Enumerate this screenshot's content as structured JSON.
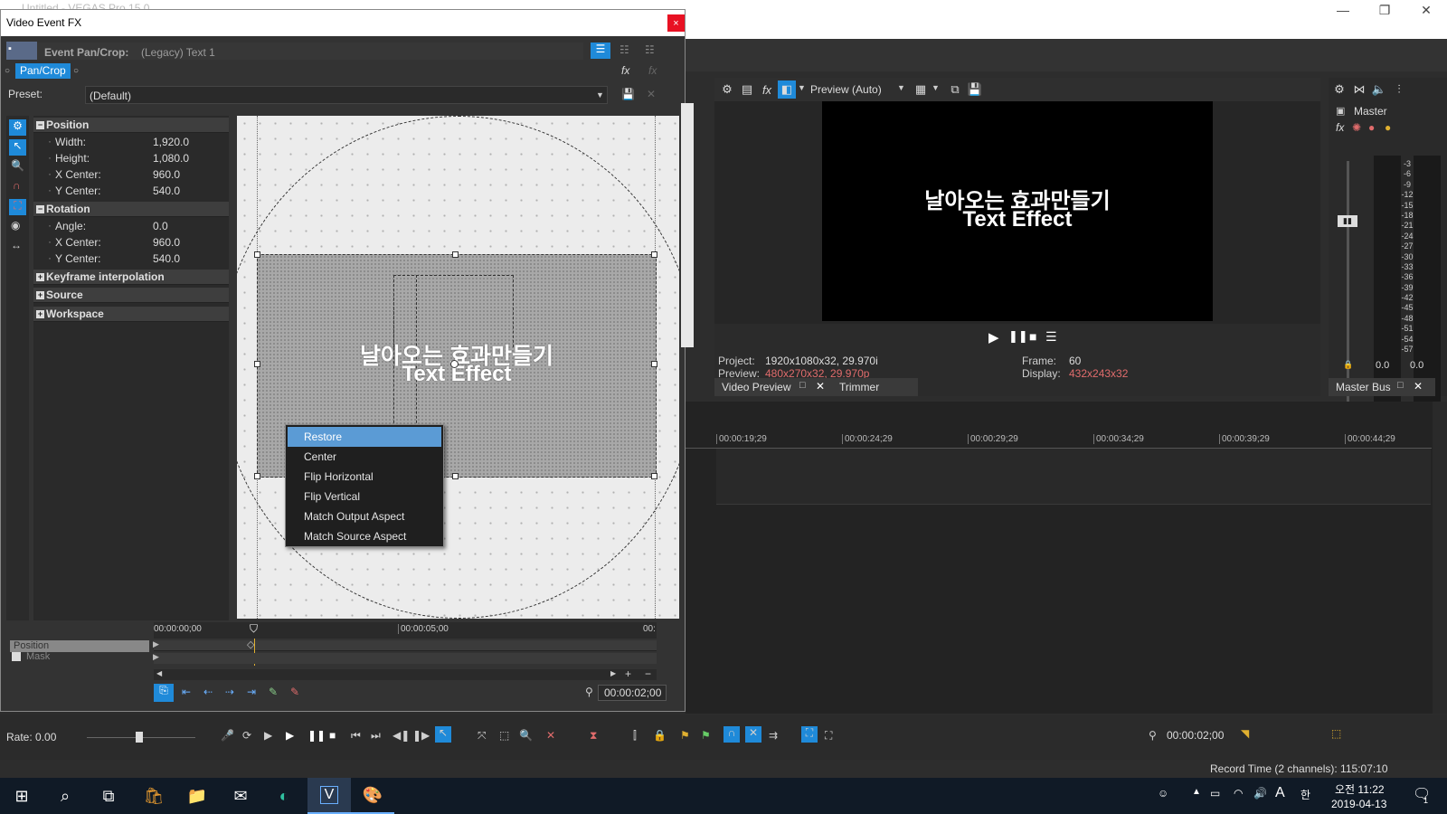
{
  "app": {
    "title": "Untitled - VEGAS Pro 15.0"
  },
  "dialog": {
    "title": "Video Event FX",
    "close_glyph": "×",
    "event_label": "Event Pan/Crop:",
    "event_name": "(Legacy) Text 1",
    "chain_tab": "Pan/Crop",
    "preset_label": "Preset:",
    "preset_value": "(Default)",
    "sections": {
      "position": {
        "title": "Position",
        "rows": [
          {
            "label": "Width:",
            "value": "1,920.0"
          },
          {
            "label": "Height:",
            "value": "1,080.0"
          },
          {
            "label": "X Center:",
            "value": "960.0"
          },
          {
            "label": "Y Center:",
            "value": "540.0"
          }
        ]
      },
      "rotation": {
        "title": "Rotation",
        "rows": [
          {
            "label": "Angle:",
            "value": "0.0"
          },
          {
            "label": "X Center:",
            "value": "960.0"
          },
          {
            "label": "Y Center:",
            "value": "540.0"
          }
        ]
      },
      "keyframe": {
        "title": "Keyframe interpolation"
      },
      "source": {
        "title": "Source"
      },
      "workspace": {
        "title": "Workspace"
      }
    },
    "canvas_text": {
      "line1": "날아오는 효과만들기",
      "line2": "Text Effect"
    },
    "context_menu": [
      {
        "label": "Restore",
        "selected": true
      },
      {
        "label": "Center"
      },
      {
        "label": "Flip Horizontal"
      },
      {
        "label": "Flip Vertical"
      },
      {
        "label": "Match Output Aspect"
      },
      {
        "label": "Match Source Aspect"
      }
    ],
    "keyframe_ruler": {
      "t0": "00:00:00;00",
      "t1": "00:00:05;00",
      "t2": "00:"
    },
    "tracks": {
      "position": "Position",
      "mask": "Mask"
    },
    "timecode": "00:00:02;00"
  },
  "preview": {
    "mode": "Preview (Auto)",
    "text_line1": "날아오는 효과만들기",
    "text_line2": "Text Effect",
    "project_label": "Project:",
    "project_value": "1920x1080x32, 29.970i",
    "preview_label": "Preview:",
    "preview_value": "480x270x32, 29.970p",
    "frame_label": "Frame:",
    "frame_value": "60",
    "display_label": "Display:",
    "display_value": "432x243x32",
    "tab_video_preview": "Video Preview",
    "tab_trimmer": "Trimmer",
    "accent_color": "#e06c6c"
  },
  "master": {
    "label": "Master",
    "meter_ticks": [
      "3",
      "6",
      "9",
      "12",
      "15",
      "18",
      "21",
      "24",
      "27",
      "30",
      "33",
      "36",
      "39",
      "42",
      "45",
      "48",
      "51",
      "54",
      "57"
    ],
    "left_value": "0.0",
    "right_value": "0.0",
    "tab": "Master Bus"
  },
  "timeline": {
    "ruler": [
      "00:00:19;29",
      "00:00:24;29",
      "00:00:29;29",
      "00:00:34;29",
      "00:00:39;29",
      "00:00:44;29"
    ]
  },
  "status": {
    "rate": "Rate: 0.00",
    "cursor_time": "00:00:02;00",
    "record_time": "Record Time (2 channels): 115:07:10"
  },
  "taskbar": {
    "clock_line1": "오전 11:22",
    "clock_line2": "2019-04-13",
    "ime": "A",
    "lang": "한",
    "notif": "1"
  }
}
